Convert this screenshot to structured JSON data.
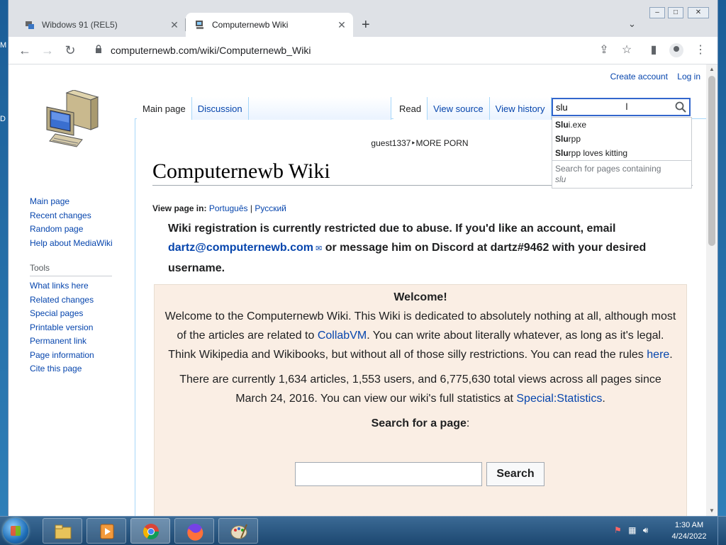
{
  "desktop": {
    "frag1": "M",
    "frag2": "D"
  },
  "browser": {
    "tabs": [
      {
        "title": "Wibdows 91 (REL5)",
        "active": false
      },
      {
        "title": "Computernewb Wiki",
        "active": true
      }
    ],
    "url": "computernewb.com/wiki/Computernewb_Wiki",
    "icons": {
      "back": "←",
      "forward": "→",
      "reload": "↻",
      "new_tab": "+",
      "tab_search": "⌄",
      "share": "⇪",
      "bookmark": "☆",
      "sidebar": "▮",
      "menu": "⋮",
      "close": "✕",
      "lock": "🔒"
    }
  },
  "wiki": {
    "personal": {
      "create_account": "Create account",
      "login": "Log in"
    },
    "tabs_left": [
      {
        "label": "Main page",
        "selected": true
      },
      {
        "label": "Discussion",
        "selected": false
      }
    ],
    "tabs_right": [
      {
        "label": "Read",
        "selected": true
      },
      {
        "label": "View source",
        "selected": false
      },
      {
        "label": "View history",
        "selected": false
      }
    ],
    "search": {
      "value": "slu",
      "suggestions": [
        {
          "bold": "Slu",
          "rest": "i.exe"
        },
        {
          "bold": "Slu",
          "rest": "rpp"
        },
        {
          "bold": "Slu",
          "rest": "rpp loves kitting"
        }
      ],
      "containing_label": "Search for pages containing",
      "containing_term": "slu"
    },
    "sitenotice": "guest1337‣MORE PORN",
    "title": "Computernewb Wiki",
    "view_page_in_label": "View page in:",
    "languages": [
      "Português",
      "Русский"
    ],
    "lang_sep": "|",
    "nav": [
      "Main page",
      "Recent changes",
      "Random page",
      "Help about MediaWiki"
    ],
    "tools_heading": "Tools",
    "tools": [
      "What links here",
      "Related changes",
      "Special pages",
      "Printable version",
      "Permanent link",
      "Page information",
      "Cite this page"
    ],
    "notice": {
      "part1": "Wiki registration is currently restricted due to abuse. If you'd like an account, email",
      "email": "dartz@computernewb.com",
      "part2": "or message him on Discord at dartz#9462 with your desired username."
    },
    "welcome": {
      "title": "Welcome!",
      "p1a": "Welcome to the Computernewb Wiki. This Wiki is dedicated to absolutely nothing at all, although most of the articles are related to",
      "link1": "CollabVM",
      "p1b": ". You can write about literally whatever, as long as it's legal. Think Wikipedia and Wikibooks, but without all of those silly restrictions. You can read the rules",
      "link2": "here",
      "p1c": ".",
      "p2a": "There are currently 1,634 articles, 1,553 users, and 6,775,630 total views across all pages since March 24, 2016. You can view our wiki's full statistics at",
      "link3": "Special:Statistics",
      "p2b": ".",
      "search_title": "Search for a page",
      "search_colon": ":",
      "search_button": "Search"
    }
  },
  "taskbar": {
    "time": "1:30 AM",
    "date": "4/24/2022"
  }
}
